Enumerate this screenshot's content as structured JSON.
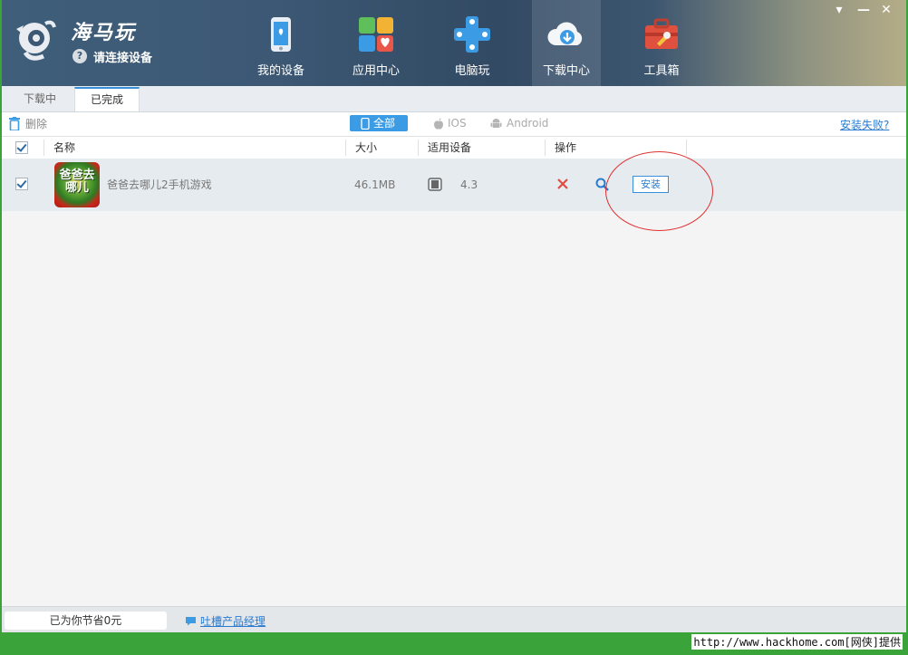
{
  "app": {
    "name": "海马玩",
    "connect_prompt": "请连接设备",
    "help_glyph": "?"
  },
  "nav": [
    {
      "label": "我的设备",
      "icon": "phone-icon"
    },
    {
      "label": "应用中心",
      "icon": "app-grid-icon"
    },
    {
      "label": "电脑玩",
      "icon": "gamepad-icon"
    },
    {
      "label": "下载中心",
      "icon": "cloud-download-icon",
      "active": true
    },
    {
      "label": "工具箱",
      "icon": "toolbox-icon"
    }
  ],
  "window_controls": {
    "menu": "▾",
    "minimize": "—",
    "close": "✕"
  },
  "tabs": [
    {
      "label": "下载中",
      "active": false
    },
    {
      "label": "已完成",
      "active": true
    }
  ],
  "toolbar": {
    "delete_label": "删除",
    "filters": [
      {
        "label": "全部",
        "active": true
      },
      {
        "label": "IOS",
        "active": false
      },
      {
        "label": "Android",
        "active": false
      }
    ],
    "install_failed_link": "安装失败?"
  },
  "table": {
    "columns": [
      "名称",
      "大小",
      "适用设备",
      "操作"
    ],
    "rows": [
      {
        "checked": true,
        "icon_text": "爸爸去哪儿",
        "name": "爸爸去哪儿2手机游戏",
        "size": "46.1MB",
        "device_version": "4.3",
        "install_label": "安装"
      }
    ]
  },
  "status": {
    "saved_text": "已为你节省0元",
    "feedback_link": "吐槽产品经理"
  },
  "watermark": "http://www.hackhome.com[网侠]提供",
  "colors": {
    "accent": "#3b9be5",
    "link": "#2a7bd0",
    "delete_x": "#e04a3f",
    "annotation_circle": "#e03030",
    "frame_green": "#3aa33a"
  }
}
